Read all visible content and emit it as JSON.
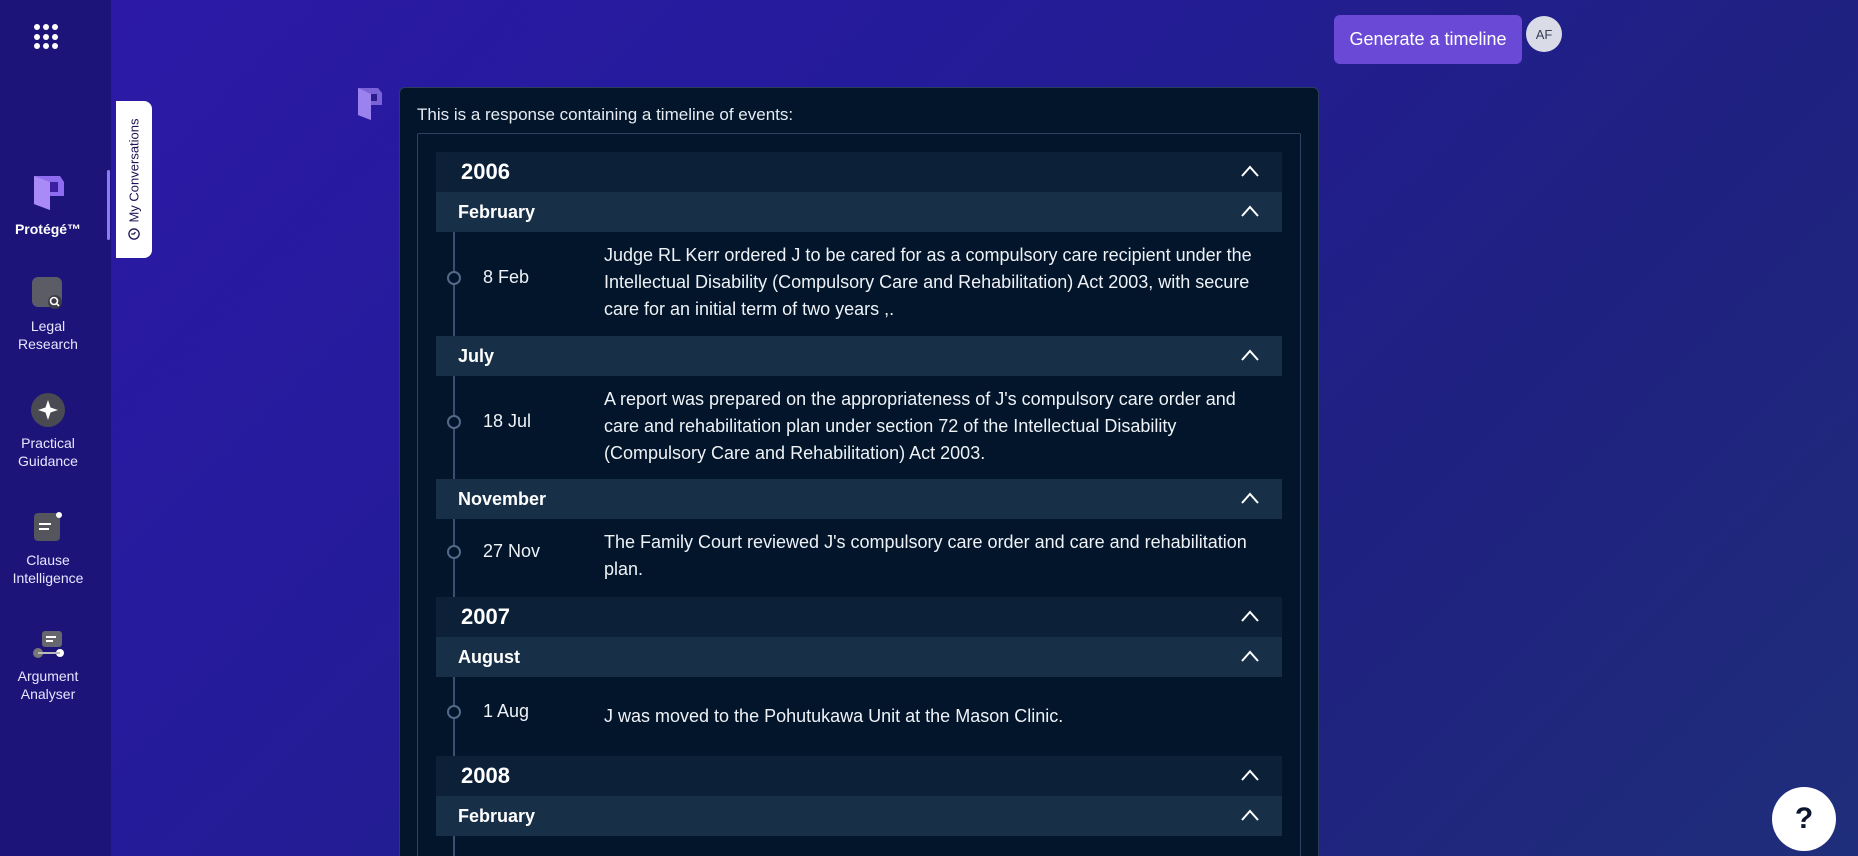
{
  "sidebar": {
    "items": [
      {
        "label": "Protégé™",
        "icon": "protege-logo-icon"
      },
      {
        "label": "Legal\nResearch",
        "icon": "legal-research-icon"
      },
      {
        "label": "Practical\nGuidance",
        "icon": "sparkle-icon"
      },
      {
        "label": "Clause\nIntelligence",
        "icon": "clause-document-icon"
      },
      {
        "label": "Argument\nAnalyser",
        "icon": "argument-analyser-icon"
      }
    ]
  },
  "conversations_tab": {
    "label": "My Conversations",
    "icon": "history-icon"
  },
  "header": {
    "generate_button": "Generate a timeline",
    "avatar_initials": "AF"
  },
  "response": {
    "intro": "This is a response containing a timeline of events:",
    "timeline": {
      "y2006": {
        "year": "2006"
      },
      "feb2006": {
        "month": "February",
        "date": "8 Feb",
        "text": "Judge RL Kerr ordered J to be cared for as a compulsory care recipient under the Intellectual Disability (Compulsory Care and Rehabilitation) Act 2003, with secure care for an initial term of two years ,."
      },
      "jul2006": {
        "month": "July",
        "date": "18 Jul",
        "text": "A report was prepared on the appropriateness of J's compulsory care order and care and rehabilitation plan under section 72 of the Intellectual Disability (Compulsory Care and Rehabilitation) Act 2003."
      },
      "nov2006": {
        "month": "November",
        "date": "27 Nov",
        "text": "The Family Court reviewed J's compulsory care order and care and rehabilitation plan."
      },
      "y2007": {
        "year": "2007"
      },
      "aug2007": {
        "month": "August",
        "date": "1 Aug",
        "text": "J was moved to the Pohutukawa Unit at the Mason Clinic."
      },
      "y2008": {
        "year": "2008"
      },
      "feb2008": {
        "month": "February"
      }
    }
  },
  "help_button": "?"
}
